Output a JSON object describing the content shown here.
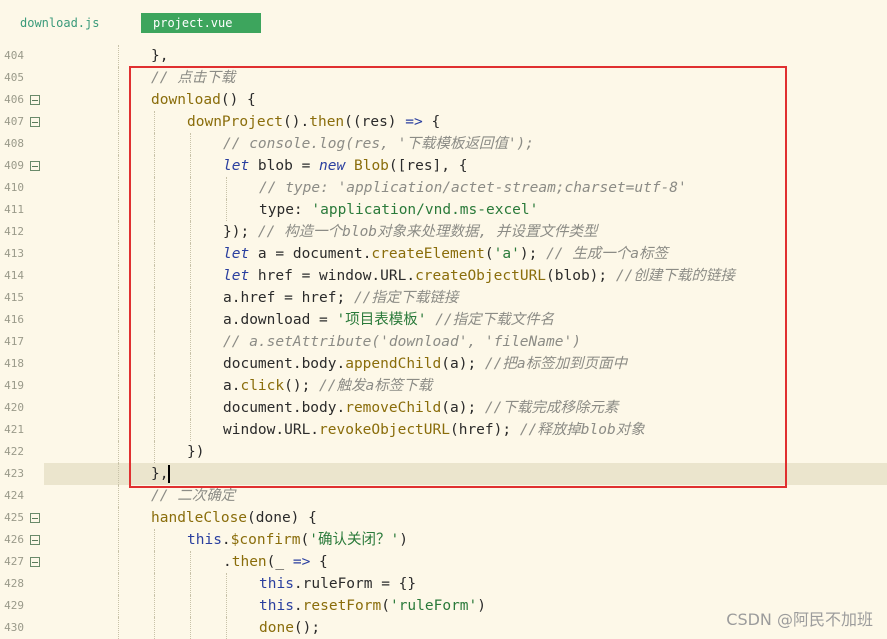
{
  "tabs": [
    {
      "label": "download.js",
      "active": false
    },
    {
      "label": "project.vue",
      "active": true
    }
  ],
  "lines": [
    {
      "num": "404",
      "fold": false,
      "indent": 2,
      "tokens": [
        [
          "op",
          "},"
        ]
      ]
    },
    {
      "num": "405",
      "fold": false,
      "indent": 2,
      "tokens": [
        [
          "cm",
          "// 点击下载"
        ]
      ]
    },
    {
      "num": "406",
      "fold": true,
      "indent": 2,
      "tokens": [
        [
          "fn",
          "download"
        ],
        [
          "op",
          "() {"
        ]
      ]
    },
    {
      "num": "407",
      "fold": true,
      "indent": 3,
      "tokens": [
        [
          "fn",
          "downProject"
        ],
        [
          "op",
          "()."
        ],
        [
          "fn",
          "then"
        ],
        [
          "op",
          "((res) "
        ],
        [
          "kw",
          "=>"
        ],
        [
          "op",
          " {"
        ]
      ]
    },
    {
      "num": "408",
      "fold": false,
      "indent": 4,
      "tokens": [
        [
          "cm",
          "// console.log(res, '下载模板返回值');"
        ]
      ]
    },
    {
      "num": "409",
      "fold": true,
      "indent": 4,
      "tokens": [
        [
          "kw",
          "let"
        ],
        [
          "op",
          " blob = "
        ],
        [
          "kw",
          "new"
        ],
        [
          "op",
          " "
        ],
        [
          "fn",
          "Blob"
        ],
        [
          "op",
          "([res], {"
        ]
      ]
    },
    {
      "num": "410",
      "fold": false,
      "indent": 5,
      "tokens": [
        [
          "cm",
          "// type: 'application/actet-stream;charset=utf-8'"
        ]
      ]
    },
    {
      "num": "411",
      "fold": false,
      "indent": 5,
      "tokens": [
        [
          "op",
          "type: "
        ],
        [
          "str",
          "'application/vnd.ms-excel'"
        ]
      ]
    },
    {
      "num": "412",
      "fold": false,
      "indent": 4,
      "tokens": [
        [
          "op",
          "}); "
        ],
        [
          "cm",
          "// 构造一个blob对象来处理数据, 并设置文件类型"
        ]
      ]
    },
    {
      "num": "413",
      "fold": false,
      "indent": 4,
      "tokens": [
        [
          "kw",
          "let"
        ],
        [
          "op",
          " a = document."
        ],
        [
          "fn",
          "createElement"
        ],
        [
          "op",
          "("
        ],
        [
          "str",
          "'a'"
        ],
        [
          "op",
          "); "
        ],
        [
          "cm",
          "// 生成一个a标签"
        ]
      ]
    },
    {
      "num": "414",
      "fold": false,
      "indent": 4,
      "tokens": [
        [
          "kw",
          "let"
        ],
        [
          "op",
          " href = window.URL."
        ],
        [
          "fn",
          "createObjectURL"
        ],
        [
          "op",
          "(blob); "
        ],
        [
          "cm",
          "//创建下载的链接"
        ]
      ]
    },
    {
      "num": "415",
      "fold": false,
      "indent": 4,
      "tokens": [
        [
          "op",
          "a.href = href; "
        ],
        [
          "cm",
          "//指定下载链接"
        ]
      ]
    },
    {
      "num": "416",
      "fold": false,
      "indent": 4,
      "tokens": [
        [
          "op",
          "a.download = "
        ],
        [
          "str",
          "'项目表模板'"
        ],
        [
          "op",
          " "
        ],
        [
          "cm",
          "//指定下载文件名"
        ]
      ]
    },
    {
      "num": "417",
      "fold": false,
      "indent": 4,
      "tokens": [
        [
          "cm",
          "// a.setAttribute('download', 'fileName')"
        ]
      ]
    },
    {
      "num": "418",
      "fold": false,
      "indent": 4,
      "tokens": [
        [
          "op",
          "document.body."
        ],
        [
          "fn",
          "appendChild"
        ],
        [
          "op",
          "(a); "
        ],
        [
          "cm",
          "//把a标签加到页面中"
        ]
      ]
    },
    {
      "num": "419",
      "fold": false,
      "indent": 4,
      "tokens": [
        [
          "op",
          "a."
        ],
        [
          "fn",
          "click"
        ],
        [
          "op",
          "(); "
        ],
        [
          "cm",
          "//触发a标签下载"
        ]
      ]
    },
    {
      "num": "420",
      "fold": false,
      "indent": 4,
      "tokens": [
        [
          "op",
          "document.body."
        ],
        [
          "fn",
          "removeChild"
        ],
        [
          "op",
          "(a); "
        ],
        [
          "cm",
          "//下载完成移除元素"
        ]
      ]
    },
    {
      "num": "421",
      "fold": false,
      "indent": 4,
      "tokens": [
        [
          "op",
          "window.URL."
        ],
        [
          "fn",
          "revokeObjectURL"
        ],
        [
          "op",
          "(href); "
        ],
        [
          "cm",
          "//释放掉blob对象"
        ]
      ]
    },
    {
      "num": "422",
      "fold": false,
      "indent": 3,
      "tokens": [
        [
          "op",
          "})"
        ]
      ]
    },
    {
      "num": "423",
      "fold": false,
      "indent": 2,
      "current": true,
      "tokens": [
        [
          "op",
          "},"
        ]
      ]
    },
    {
      "num": "424",
      "fold": false,
      "indent": 2,
      "tokens": [
        [
          "cm",
          "// 二次确定"
        ]
      ]
    },
    {
      "num": "425",
      "fold": true,
      "indent": 2,
      "tokens": [
        [
          "fn",
          "handleClose"
        ],
        [
          "op",
          "(done) {"
        ]
      ]
    },
    {
      "num": "426",
      "fold": true,
      "indent": 3,
      "tokens": [
        [
          "th",
          "this"
        ],
        [
          "op",
          "."
        ],
        [
          "fn",
          "$confirm"
        ],
        [
          "op",
          "("
        ],
        [
          "str",
          "'确认关闭？'"
        ],
        [
          "op",
          ")"
        ]
      ]
    },
    {
      "num": "427",
      "fold": true,
      "indent": 4,
      "tokens": [
        [
          "op",
          "."
        ],
        [
          "fn",
          "then"
        ],
        [
          "op",
          "(_ "
        ],
        [
          "kw",
          "=>"
        ],
        [
          "op",
          " {"
        ]
      ]
    },
    {
      "num": "428",
      "fold": false,
      "indent": 5,
      "tokens": [
        [
          "th",
          "this"
        ],
        [
          "op",
          ".ruleForm = {}"
        ]
      ]
    },
    {
      "num": "429",
      "fold": false,
      "indent": 5,
      "tokens": [
        [
          "th",
          "this"
        ],
        [
          "op",
          "."
        ],
        [
          "fn",
          "resetForm"
        ],
        [
          "op",
          "("
        ],
        [
          "str",
          "'ruleForm'"
        ],
        [
          "op",
          ")"
        ]
      ]
    },
    {
      "num": "430",
      "fold": false,
      "indent": 5,
      "tokens": [
        [
          "fn",
          "done"
        ],
        [
          "op",
          "();"
        ]
      ]
    }
  ],
  "watermark": "CSDN @阿民不加班",
  "colors": {
    "highlight_box": "#e03030",
    "active_tab": "#3da55d",
    "background": "#fdf8e8"
  }
}
